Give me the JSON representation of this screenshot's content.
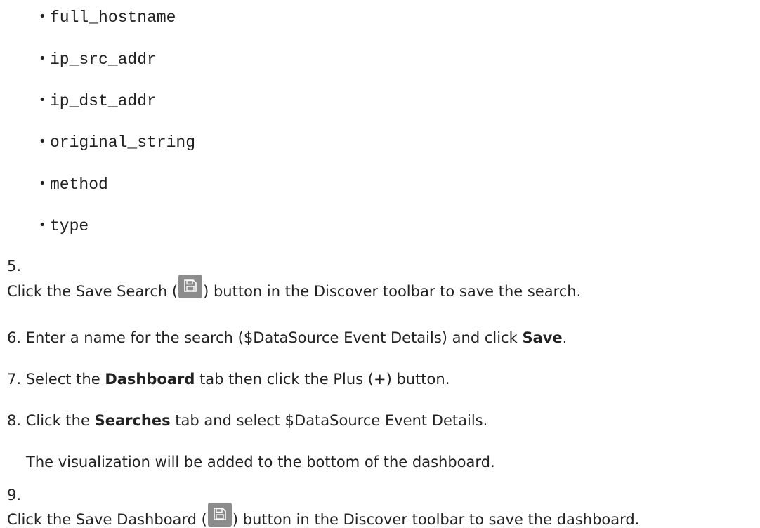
{
  "bullets": [
    "full_hostname",
    "ip_src_addr",
    "ip_dst_addr",
    "original_string",
    "method",
    "type"
  ],
  "step5": {
    "number": "5.",
    "before": "Click the Save Search (",
    "after": ") button in the Discover toolbar to save the search.",
    "icon": "save-icon"
  },
  "step6": {
    "prefix": "6. Enter a name for the search ($DataSource Event Details) and click ",
    "bold": "Save",
    "suffix": "."
  },
  "step7": {
    "prefix": "7. Select the ",
    "bold": "Dashboard",
    "suffix": " tab then click the Plus (+) button."
  },
  "step8": {
    "prefix": "8. Click the ",
    "bold": "Searches",
    "suffix": " tab and select $DataSource Event Details."
  },
  "step8_note": "The visualization will be added to the bottom of the dashboard.",
  "step9": {
    "number": "9.",
    "before": "Click the Save Dashboard (",
    "after": ") button in the Discover toolbar to save the dashboard.",
    "icon": "save-icon"
  }
}
